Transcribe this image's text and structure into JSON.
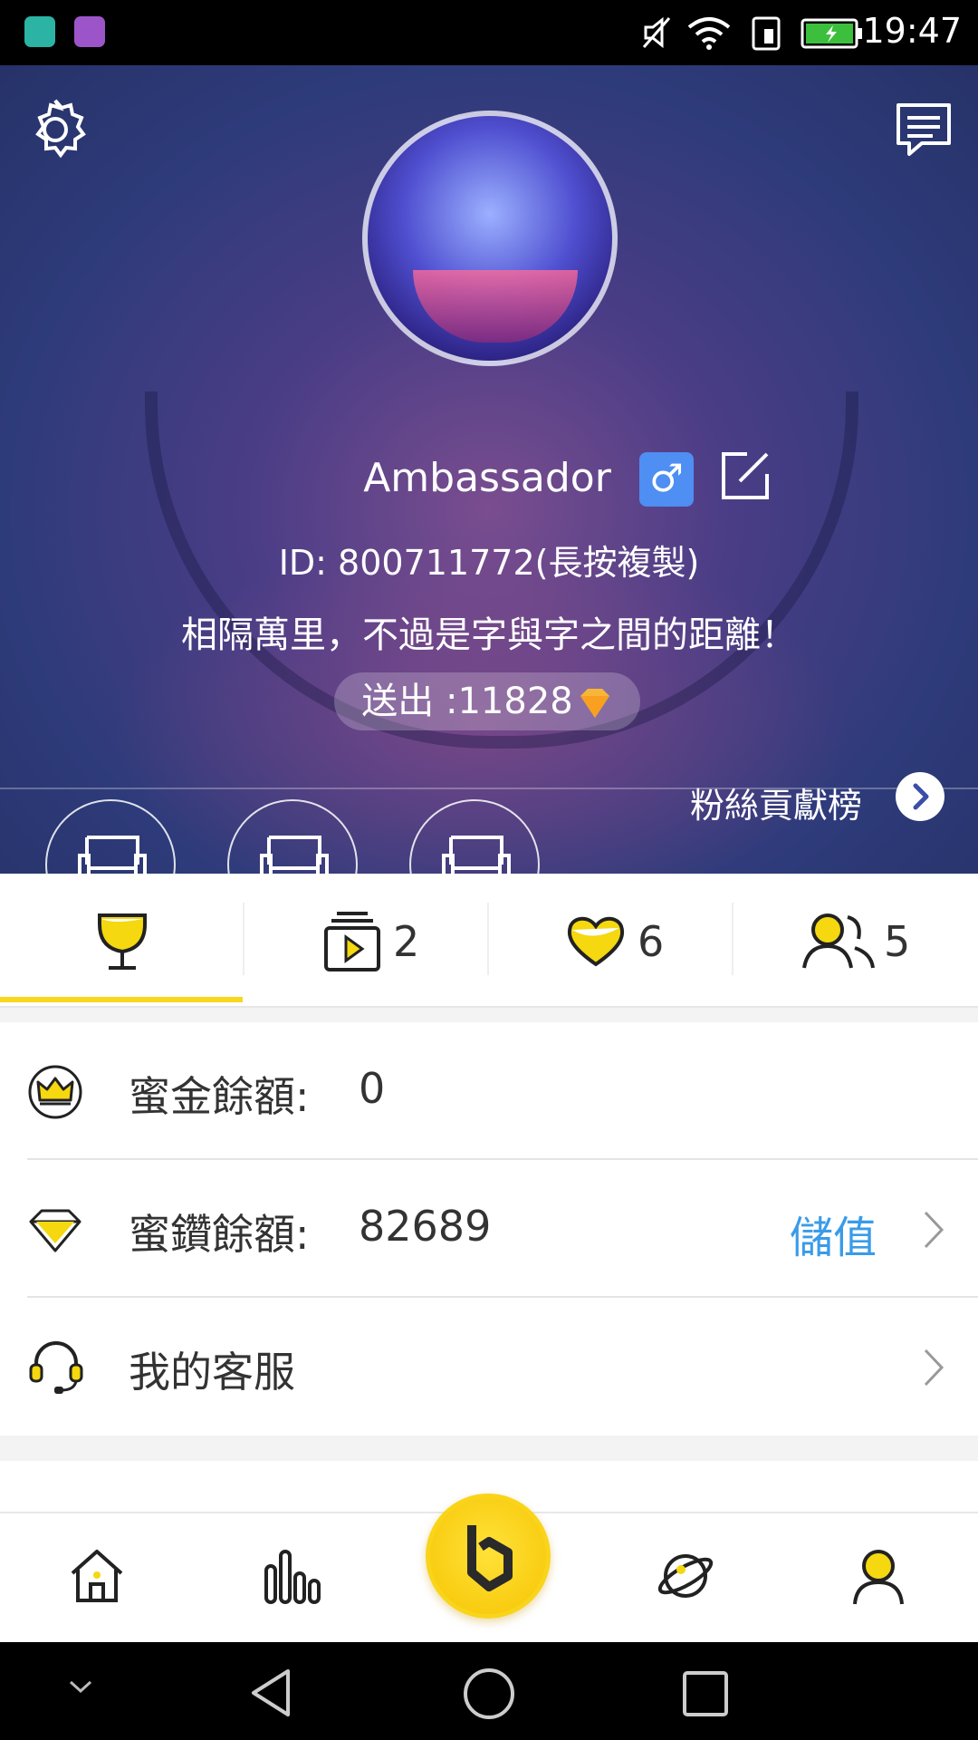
{
  "status_bar": {
    "time": "19:47"
  },
  "profile": {
    "name": "Ambassador",
    "gender_symbol": "♂",
    "id_text": "ID: 800711772(長按複製)",
    "bio": "相隔萬里，不過是字與字之間的距離！",
    "sent_label": "送出 :11828"
  },
  "fans": {
    "label": "粉絲貢獻榜"
  },
  "tabs": [
    {
      "icon": "trophy-icon",
      "count": ""
    },
    {
      "icon": "video-icon",
      "count": "2"
    },
    {
      "icon": "heart-icon",
      "count": "6"
    },
    {
      "icon": "users-icon",
      "count": "5"
    }
  ],
  "rows": [
    {
      "label": "蜜金餘額:",
      "value": "0"
    },
    {
      "label": "蜜鑽餘額:",
      "value": "82689",
      "action": "儲值"
    },
    {
      "label": "我的客服"
    }
  ],
  "colors": {
    "accent": "#f8d71c",
    "link": "#3a9be8"
  }
}
